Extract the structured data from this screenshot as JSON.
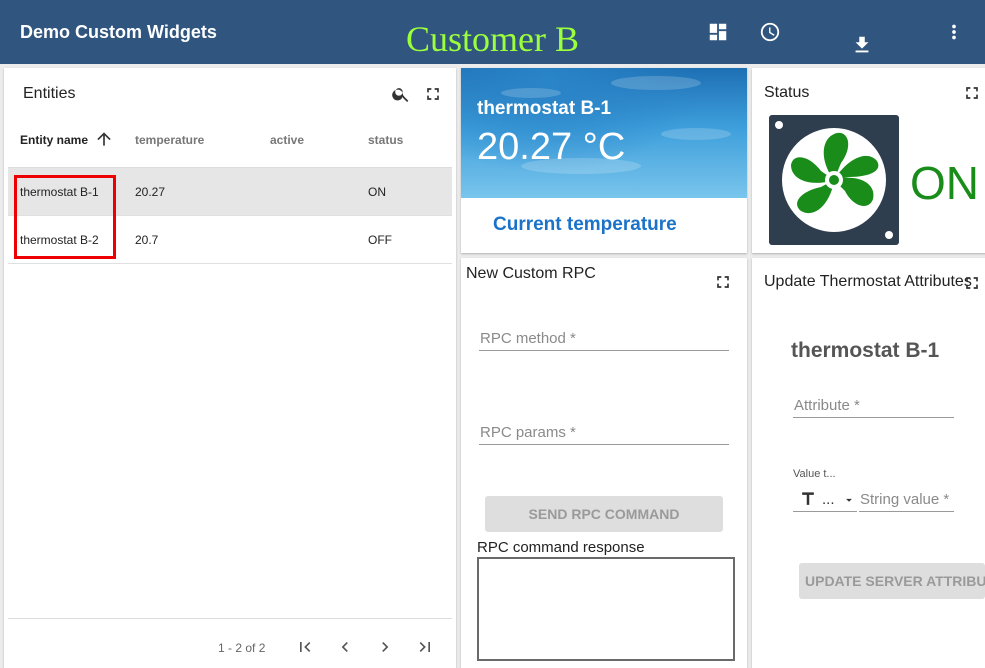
{
  "header": {
    "app_title": "Demo Custom Widgets",
    "customer_title": "Customer B",
    "icons": [
      "dashboard-icon",
      "history-icon",
      "download-icon",
      "more-vert-icon"
    ]
  },
  "entities": {
    "title": "Entities",
    "columns": [
      "Entity name",
      "temperature",
      "active",
      "status"
    ],
    "rows": [
      {
        "name": "thermostat B-1",
        "temperature": "20.27",
        "active": "",
        "status": "ON"
      },
      {
        "name": "thermostat B-2",
        "temperature": "20.7",
        "active": "",
        "status": "OFF"
      }
    ],
    "pagination": "1 - 2 of 2"
  },
  "thermostat": {
    "name": "thermostat B-1",
    "temperature": "20.27 °C",
    "label": "Current temperature"
  },
  "status": {
    "title": "Status",
    "value": "ON",
    "color": "#1a8c1a"
  },
  "rpc": {
    "title": "New Custom RPC",
    "method_label": "RPC method",
    "params_label": "RPC params",
    "required_mark": "*",
    "send_button": "SEND RPC COMMAND",
    "response_label": "RPC command response"
  },
  "update_attributes": {
    "title": "Update Thermostat Attributes",
    "entity_name": "thermostat B-1",
    "attribute_label": "Attribute",
    "value_type_label": "Value t...",
    "value_type_selected": "...",
    "string_value_label": "String value",
    "required_mark": "*",
    "update_button": "UPDATE SERVER ATTRIBUTE"
  }
}
